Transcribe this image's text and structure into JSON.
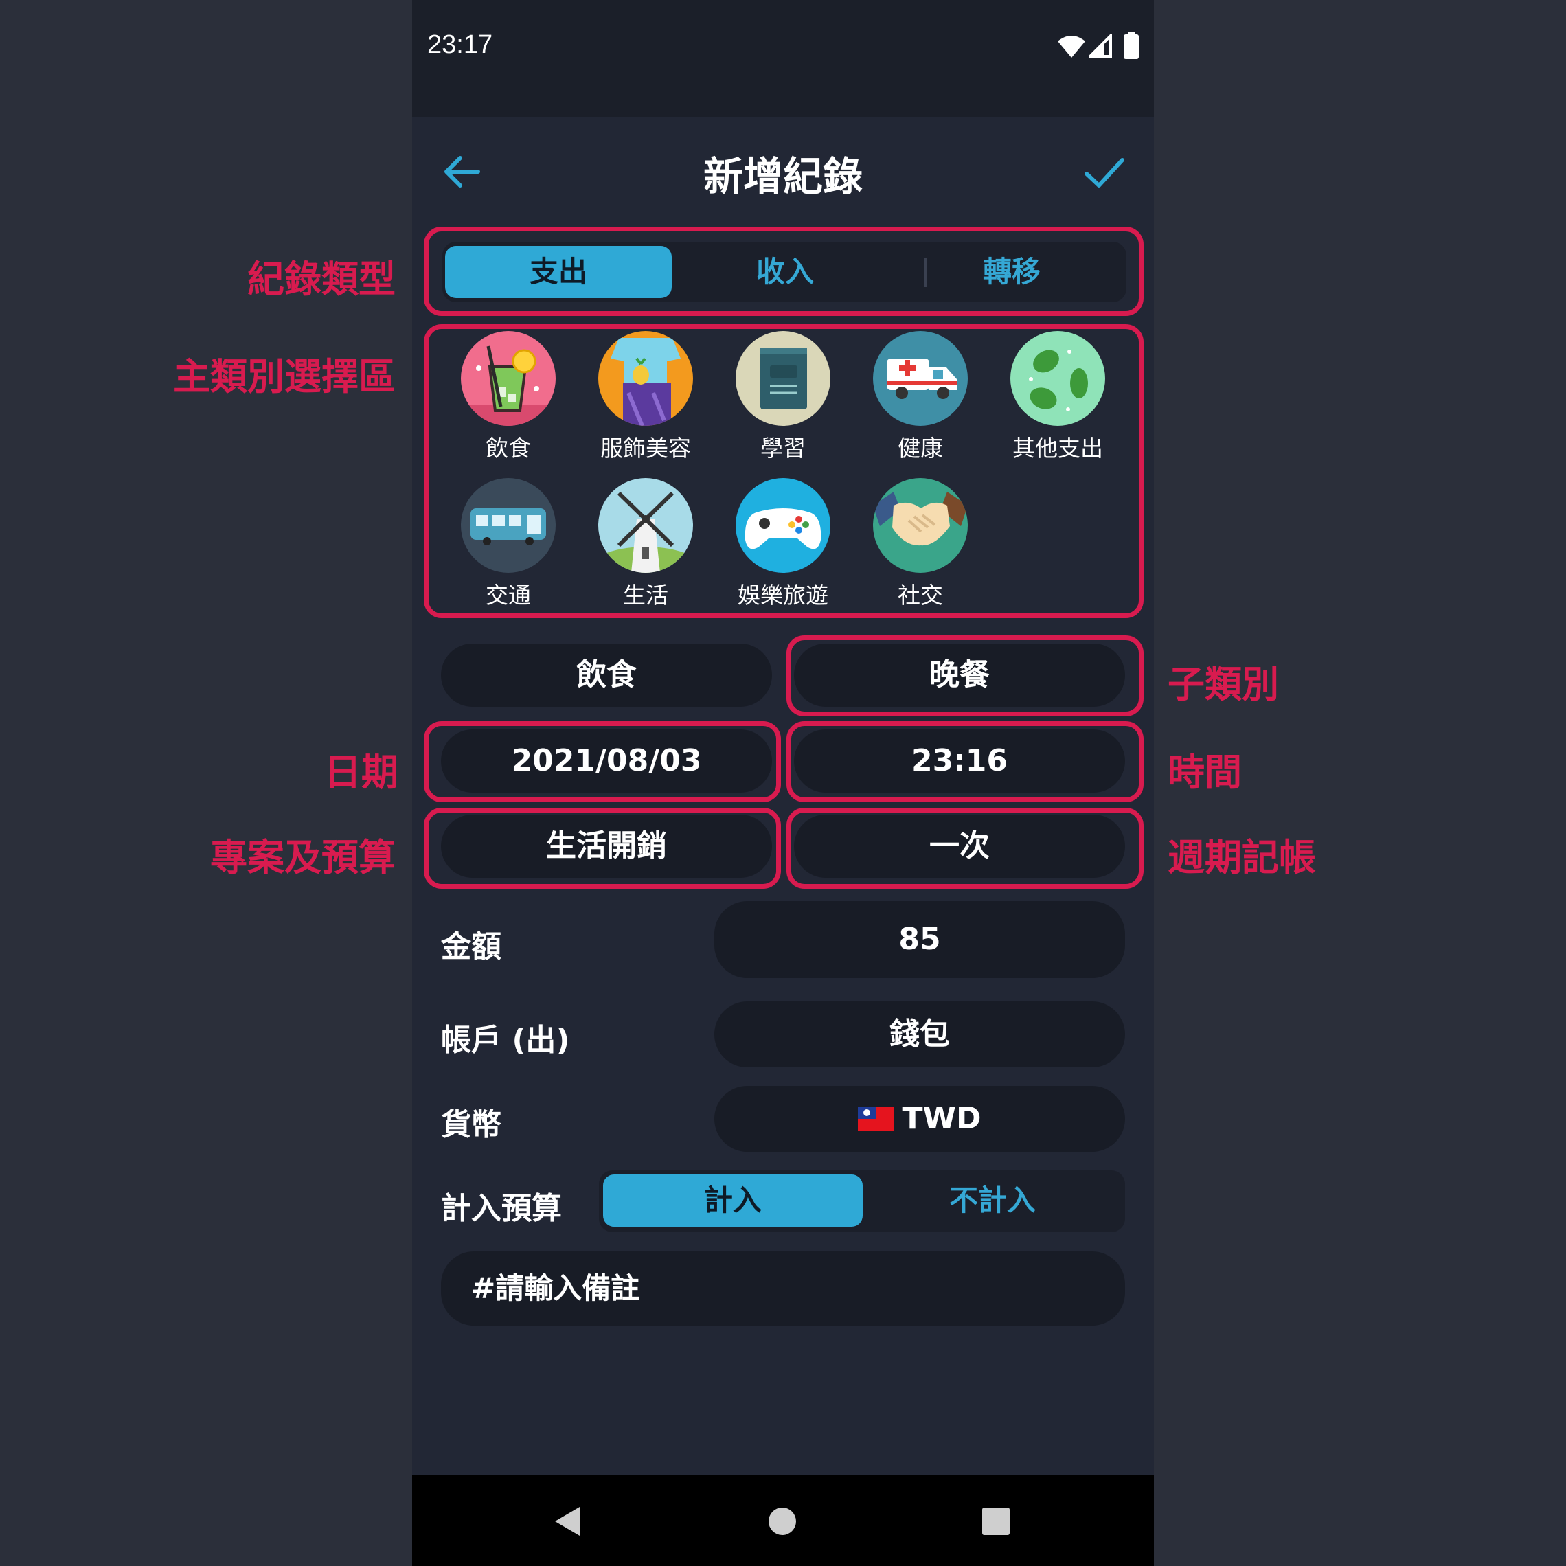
{
  "status_bar": {
    "time": "23:17",
    "icons": [
      "wifi-icon",
      "signal-icon",
      "battery-icon"
    ]
  },
  "app_bar": {
    "title": "新增紀錄",
    "back_icon": "arrow-left-icon",
    "confirm_icon": "check-icon"
  },
  "record_type": {
    "tabs": [
      "支出",
      "收入",
      "轉移"
    ],
    "selected": "支出"
  },
  "categories": [
    {
      "label": "飲食",
      "icon": "drink-icon"
    },
    {
      "label": "服飾美容",
      "icon": "clothing-icon"
    },
    {
      "label": "學習",
      "icon": "book-icon"
    },
    {
      "label": "健康",
      "icon": "ambulance-icon"
    },
    {
      "label": "其他支出",
      "icon": "leaves-icon"
    },
    {
      "label": "交通",
      "icon": "bus-icon"
    },
    {
      "label": "生活",
      "icon": "windmill-icon"
    },
    {
      "label": "娛樂旅遊",
      "icon": "gamepad-icon"
    },
    {
      "label": "社交",
      "icon": "handshake-icon"
    }
  ],
  "fields": {
    "main_category": "飲食",
    "sub_category": "晚餐",
    "date": "2021/08/03",
    "time": "23:16",
    "project": "生活開銷",
    "recurrence": "一次"
  },
  "form": {
    "amount_label": "金額",
    "amount_value": "85",
    "account_label": "帳戶 (出)",
    "account_value": "錢包",
    "currency_label": "貨幣",
    "currency_value": "TWD",
    "currency_flag": "taiwan-flag-icon",
    "budget_label": "計入預算",
    "budget_options": [
      "計入",
      "不計入"
    ],
    "budget_selected": "計入",
    "note_placeholder": "#請輸入備註"
  },
  "annotations": {
    "record_type": "紀錄類型",
    "main_category_area": "主類別選擇區",
    "sub_category": "子類別",
    "date": "日期",
    "time": "時間",
    "project_budget": "專案及預算",
    "recurring": "週期記帳"
  },
  "colors": {
    "accent": "#2fa9d6",
    "highlight": "#d81b4f",
    "background": "#222735",
    "field": "#181c26"
  }
}
